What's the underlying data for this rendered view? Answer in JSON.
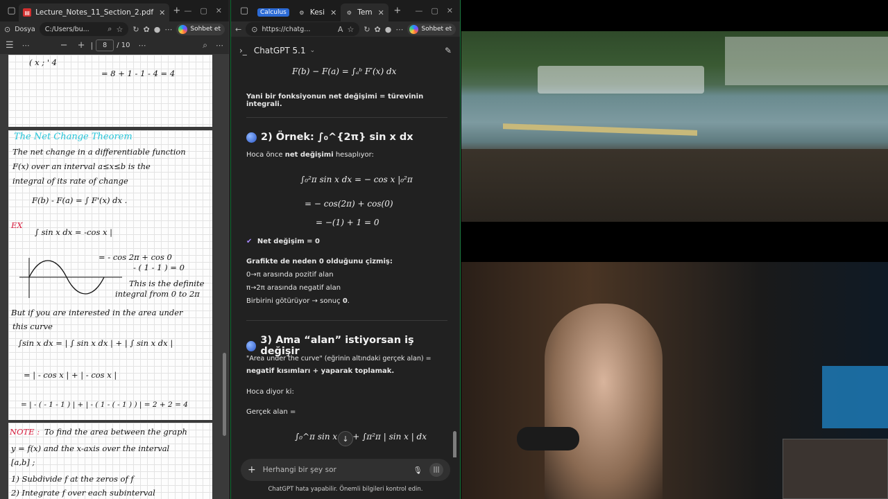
{
  "pdf_window": {
    "tab_title": "Lecture_Notes_11_Section_2.pdf",
    "address_label": "Dosya",
    "address_path": "C:/Users/bu...",
    "copilot_label": "Sohbet et",
    "page_current": "8",
    "page_total": "/ 10",
    "notes": {
      "line_top": "= 8 + 1 - 1 - 4 = 4",
      "heading": "The  Net  Change  Theorem",
      "para1": "The net change in a differentiable function",
      "para2": "F(x) over an interval a≤x≤b is the",
      "para3": "integral of its rate of change",
      "formula": "F(b) - F(a) = ∫ F'(x) dx .",
      "ex_label": "EX",
      "ex_line1": "∫ sin x dx = -cos x |",
      "ex_line2": "= - cos 2π + cos 0",
      "ex_line3": "- ( 1 - 1 ) = 0",
      "ex_line4": "This is the definite",
      "ex_line5": "integral from 0 to 2π",
      "area_line1": "But if you are interested in the area under",
      "area_line2": "this curve",
      "area_line3": "∫sin x dx = | ∫ sin x dx | + | ∫ sin x dx |",
      "area_line4": "= | - cos x |  + | - cos x |",
      "area_line5": "= | - ( - 1 - 1 ) | + | - ( 1 - ( - 1 ) ) | = 2 + 2 = 4",
      "note_label": "NOTE :",
      "note_line1": "To find the area between the graph",
      "note_line2": "y = f(x) and the x-axis over the interval",
      "note_line3": "[a,b] ;",
      "note_line4": "1) Subdivide f at the zeros of f",
      "note_line5": "2) Integrate f over each subinterval"
    }
  },
  "chat_window": {
    "tab1": "Calculus",
    "tab2": "Kesi",
    "tab3": "Tem",
    "url": "https://chatg...",
    "copilot_label": "Sohbet et",
    "model_title": "ChatGPT 5.1",
    "formula_top": "F(b) − F(a) = ∫ₐᵇ F′(x) dx",
    "summary_pre": "Yani bir ",
    "summary_b1": "fonksiyonun net değişimi",
    "summary_mid": " = ",
    "summary_b2": "türevinin integrali",
    "summary_post": ".",
    "section2_title": "2) Örnek: ∫₀^{2π} sin x dx",
    "section2_intro_pre": "Hoca önce ",
    "section2_intro_b": "net değişimi",
    "section2_intro_post": " hesaplıyor:",
    "math_l1": "∫₀²π sin x dx = − cos x |₀²π",
    "math_l2": "= − cos(2π) + cos(0)",
    "math_l3": "= −(1) + 1 = 0",
    "check_text": "Net değişim = 0",
    "why_title": "Grafikte de neden 0 olduğunu çizmiş:",
    "why_1": "0→π arasında pozitif alan",
    "why_2": "π→2π arasında negatif alan",
    "why_3_pre": "Birbirini götürüyor → sonuç ",
    "why_3_b": "0",
    "why_3_post": ".",
    "section3_title": "3) Ama “alan” istiyorsan iş değişir",
    "s3_p1": "\"Area under the curve\" (eğrinin altındaki gerçek alan) =",
    "s3_p2": "negatif kısımları + yaparak toplamak.",
    "s3_p3": "Hoca diyor ki:",
    "s3_p4": "Gerçek alan =",
    "math_l4": "∫₀^π sin x dx + ∫π²π | sin x | dx",
    "composer_placeholder": "Herhangi bir şey sor",
    "footer_note": "ChatGPT hata yapabilir. Önemli bilgileri kontrol edin."
  },
  "colors": {
    "accent_green": "#1b7a3f",
    "handwriting_red": "#d81b3c",
    "handwriting_cyan": "#26c6da",
    "check_purple": "#a98bff"
  }
}
